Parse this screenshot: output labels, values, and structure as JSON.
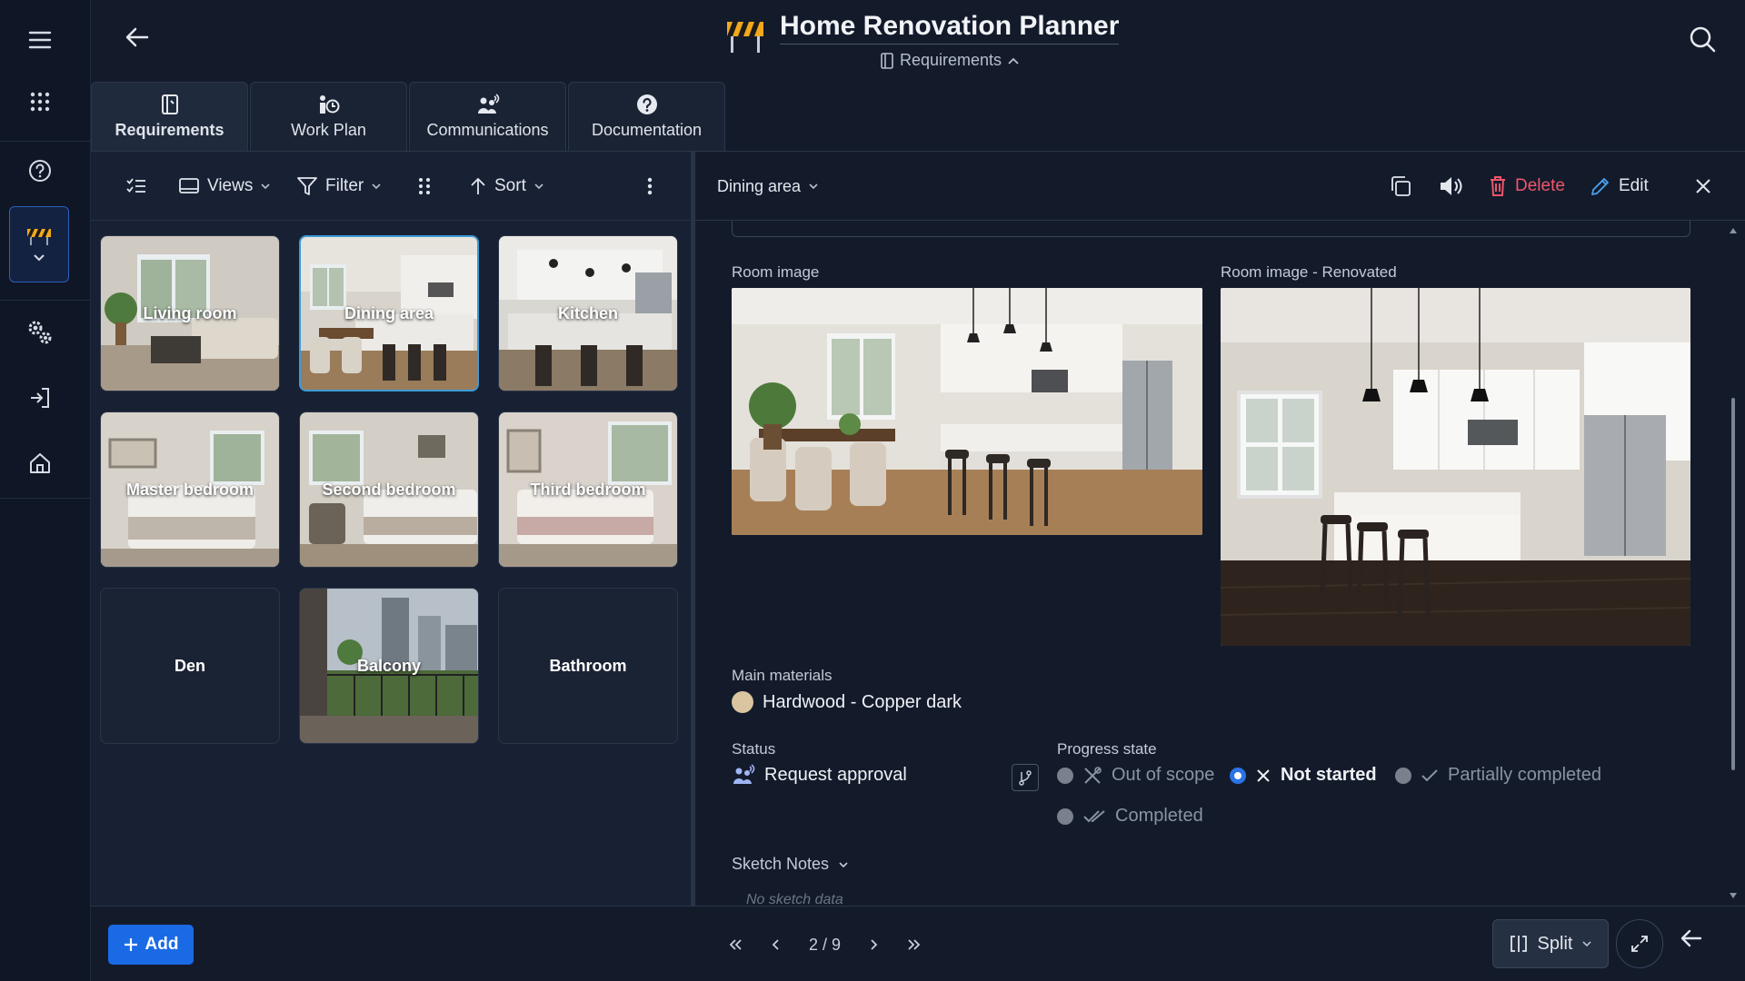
{
  "app": {
    "title": "Home Renovation Planner",
    "subtitle": "Requirements"
  },
  "tabs": [
    {
      "label": "Requirements",
      "icon": "notebook-icon",
      "active": true
    },
    {
      "label": "Work Plan",
      "icon": "person-clock-icon",
      "active": false
    },
    {
      "label": "Communications",
      "icon": "people-talking-icon",
      "active": false
    },
    {
      "label": "Documentation",
      "icon": "help-circle-icon",
      "active": false
    }
  ],
  "toolbar": {
    "views_label": "Views",
    "filter_label": "Filter",
    "sort_label": "Sort"
  },
  "rooms": [
    {
      "label": "Living room",
      "has_image": true,
      "selected": false
    },
    {
      "label": "Dining area",
      "has_image": true,
      "selected": true
    },
    {
      "label": "Kitchen",
      "has_image": true,
      "selected": false
    },
    {
      "label": "Master bedroom",
      "has_image": true,
      "selected": false
    },
    {
      "label": "Second bedroom",
      "has_image": true,
      "selected": false
    },
    {
      "label": "Third bedroom",
      "has_image": true,
      "selected": false
    },
    {
      "label": "Den",
      "has_image": false,
      "selected": false
    },
    {
      "label": "Balcony",
      "has_image": true,
      "selected": false
    },
    {
      "label": "Bathroom",
      "has_image": false,
      "selected": false
    }
  ],
  "detail": {
    "record_title": "Dining area",
    "delete_label": "Delete",
    "edit_label": "Edit",
    "room_image_label": "Room image",
    "room_image_renovated_label": "Room image - Renovated",
    "main_materials_label": "Main materials",
    "material_value": "Hardwood - Copper dark",
    "material_color": "#d9c6a0",
    "status_label": "Status",
    "status_value": "Request approval",
    "progress_label": "Progress state",
    "progress_options": [
      {
        "label": "Out of scope",
        "selected": false
      },
      {
        "label": "Not started",
        "selected": true
      },
      {
        "label": "Partially completed",
        "selected": false
      },
      {
        "label": "Completed",
        "selected": false
      }
    ],
    "sketch_notes_label": "Sketch Notes",
    "sketch_placeholder": "No sketch data"
  },
  "bottom": {
    "add_label": "Add",
    "page_indicator": "2 / 9",
    "split_label": "Split"
  },
  "colors": {
    "accent": "#1a6ae6",
    "delete": "#f0566a",
    "selection_border": "#3b9bd8"
  }
}
